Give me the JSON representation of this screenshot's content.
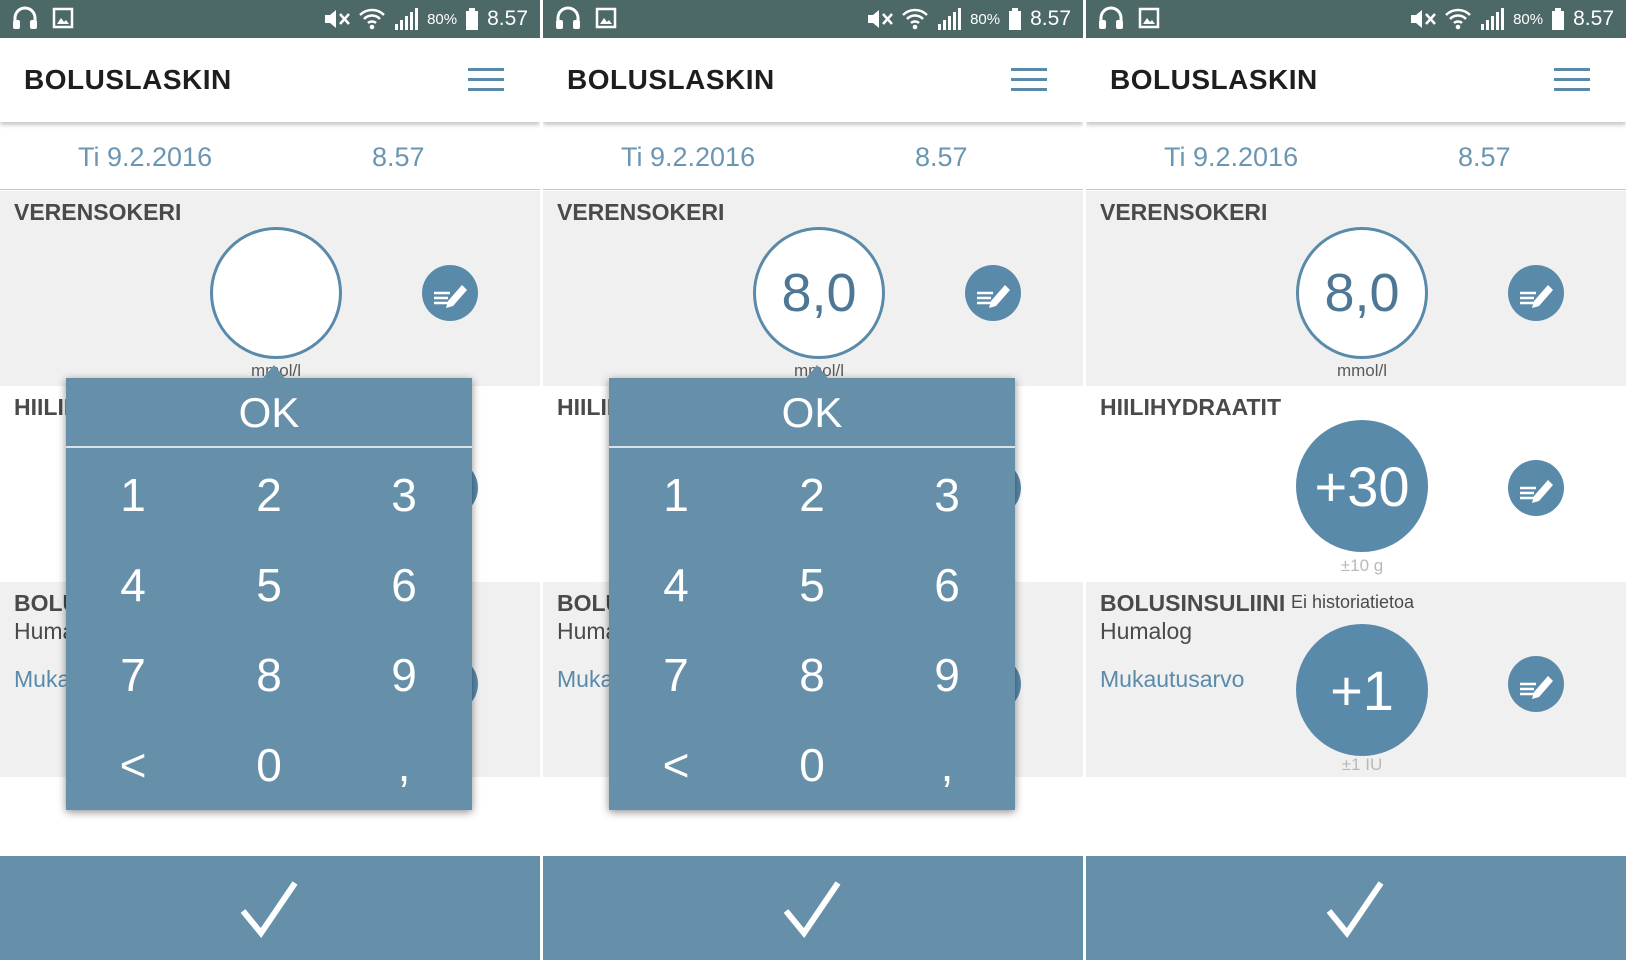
{
  "status_bar": {
    "battery": "80%",
    "time": "8.57"
  },
  "app": {
    "title": "BOLUSLASKIN"
  },
  "date_row": {
    "date": "Ti 9.2.2016",
    "time": "8.57"
  },
  "sections": {
    "blood_sugar": {
      "label": "VERENSOKERI",
      "unit": "mmol/l"
    },
    "carbs": {
      "label": "HIILIHYDRAATIT",
      "unit": "±10 g"
    },
    "insulin": {
      "label": "BOLUSINSULIINI",
      "insulin_name": "Humalog",
      "adjust_link": "Mukautusarvo",
      "no_history": "Ei historiatietoa",
      "unit": "±1 IU"
    }
  },
  "keypad": {
    "ok": "OK",
    "keys": [
      "1",
      "2",
      "3",
      "4",
      "5",
      "6",
      "7",
      "8",
      "9",
      "<",
      "0",
      ","
    ]
  },
  "screens": [
    {
      "blood_sugar_value": "",
      "keypad_open": true
    },
    {
      "blood_sugar_value": "8,0",
      "keypad_open": true
    },
    {
      "blood_sugar_value": "8,0",
      "carbs_value": "+30",
      "insulin_value": "+1",
      "keypad_open": false
    }
  ],
  "colors": {
    "status_bar": "#4c6867",
    "accent": "#6690aa",
    "accent_dark": "#5a8aaa",
    "section_gray": "#f0f0f0",
    "link": "#5a8aaa"
  },
  "icons": [
    "headphones-icon",
    "image-icon",
    "mute-icon",
    "wifi-icon",
    "signal-icon",
    "battery-icon",
    "menu-icon",
    "edit-icon",
    "checkmark-icon"
  ]
}
